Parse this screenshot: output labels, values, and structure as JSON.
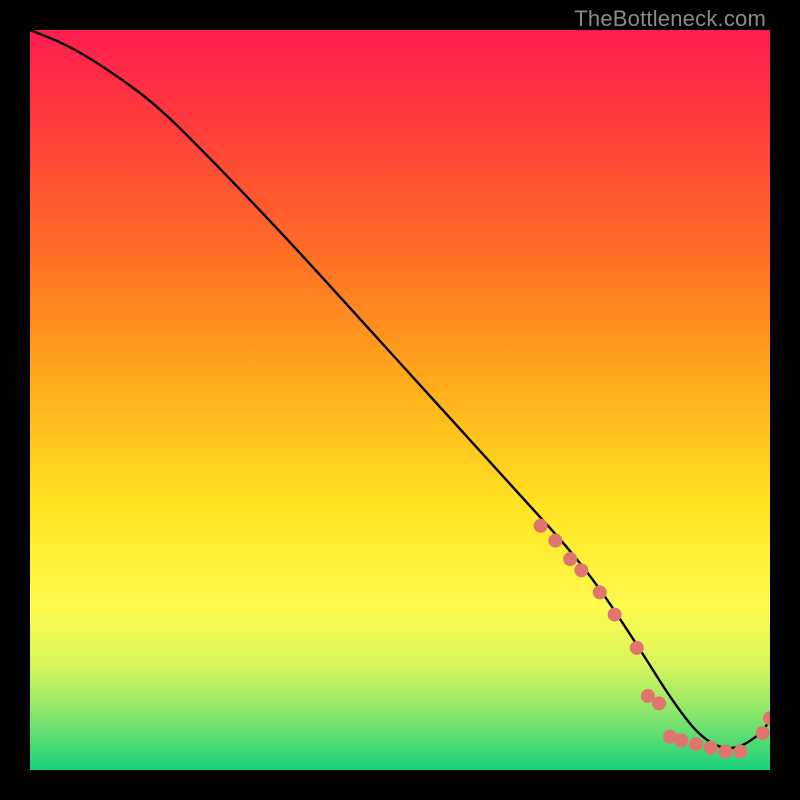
{
  "watermark": "TheBottleneck.com",
  "chart_data": {
    "type": "line",
    "title": "",
    "xlabel": "",
    "ylabel": "",
    "xrange": [
      0,
      100
    ],
    "yrange": [
      0,
      100
    ],
    "grid": false,
    "legend": false,
    "gradient_stops": [
      {
        "offset": 0.0,
        "color": "#ff1d4f"
      },
      {
        "offset": 0.12,
        "color": "#ff3a3c"
      },
      {
        "offset": 0.3,
        "color": "#ff6d25"
      },
      {
        "offset": 0.5,
        "color": "#ffb31a"
      },
      {
        "offset": 0.65,
        "color": "#ffe623"
      },
      {
        "offset": 0.78,
        "color": "#fdfb4e"
      },
      {
        "offset": 0.86,
        "color": "#d7f55a"
      },
      {
        "offset": 0.92,
        "color": "#8ee76a"
      },
      {
        "offset": 1.0,
        "color": "#18d17b"
      }
    ],
    "series": [
      {
        "name": "bottleneck-curve",
        "x": [
          0,
          5,
          10,
          17,
          25,
          35,
          45,
          55,
          65,
          75,
          82,
          87,
          91,
          95,
          99,
          100
        ],
        "y": [
          100,
          98,
          95,
          90,
          82,
          71.5,
          60.5,
          49.5,
          38.5,
          27.5,
          17,
          9,
          4,
          2.5,
          5,
          7
        ]
      }
    ],
    "markers": {
      "name": "highlight-dots",
      "color": "#e0756e",
      "radius": 7,
      "x": [
        69,
        71,
        73,
        74.5,
        77,
        79,
        82,
        83.5,
        85,
        86.5,
        88,
        90,
        92,
        94,
        96,
        99,
        100
      ],
      "y": [
        33,
        31,
        28.5,
        27,
        24,
        21,
        16.5,
        10,
        9,
        4.5,
        4,
        3.5,
        3,
        2.5,
        2.5,
        5,
        7
      ]
    }
  }
}
